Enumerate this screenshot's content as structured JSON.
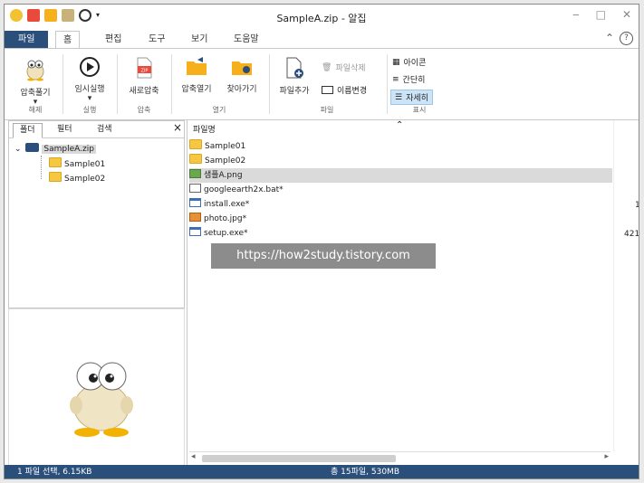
{
  "window": {
    "title": "SampleA.zip - 알집"
  },
  "menu_tabs": [
    {
      "label": "파일"
    },
    {
      "label": "홈"
    },
    {
      "label": "편집"
    },
    {
      "label": "도구"
    },
    {
      "label": "보기"
    },
    {
      "label": "도움말"
    }
  ],
  "ribbon": {
    "extract": "압축풀기",
    "extract_group": "해제",
    "temp_run": "임시실행",
    "temp_run_group": "실행",
    "new_zip": "새로압축",
    "new_zip_group": "압축",
    "zip_open": "압축열기",
    "find": "찾아가기",
    "open_group": "열기",
    "add_file": "파일추가",
    "delete_file": "파일삭제",
    "rename": "이름변경",
    "file_group": "파일",
    "view_icon": "아이콘",
    "view_simple": "간단히",
    "view_detail": "자세히",
    "view_group": "표시"
  },
  "left_panel": {
    "tabs": [
      {
        "label": "폴더"
      },
      {
        "label": "필터"
      },
      {
        "label": "검색"
      }
    ],
    "close_icon": "×",
    "tree": {
      "root": "SampleA.zip",
      "children": [
        "Sample01",
        "Sample02"
      ]
    }
  },
  "file_list": {
    "column_header": "파일명",
    "rows": [
      {
        "name": "Sample01",
        "type": "folder"
      },
      {
        "name": "Sample02",
        "type": "folder"
      },
      {
        "name": "샘플A.png",
        "type": "image"
      },
      {
        "name": "googleearth2x.bat*",
        "type": "batch"
      },
      {
        "name": "install.exe*",
        "type": "exe"
      },
      {
        "name": "photo.jpg*",
        "type": "photo"
      },
      {
        "name": "setup.exe*",
        "type": "exe"
      }
    ],
    "partial_values": [
      "1",
      "421"
    ]
  },
  "watermark": "https://how2study.tistory.com",
  "status": {
    "left": "1 파일 선택, 6.15KB",
    "center": "총 15파일, 530MB"
  },
  "colors": {
    "accent": "#2b4f7b",
    "folder": "#f5c742",
    "selected_row": "#dadada"
  }
}
